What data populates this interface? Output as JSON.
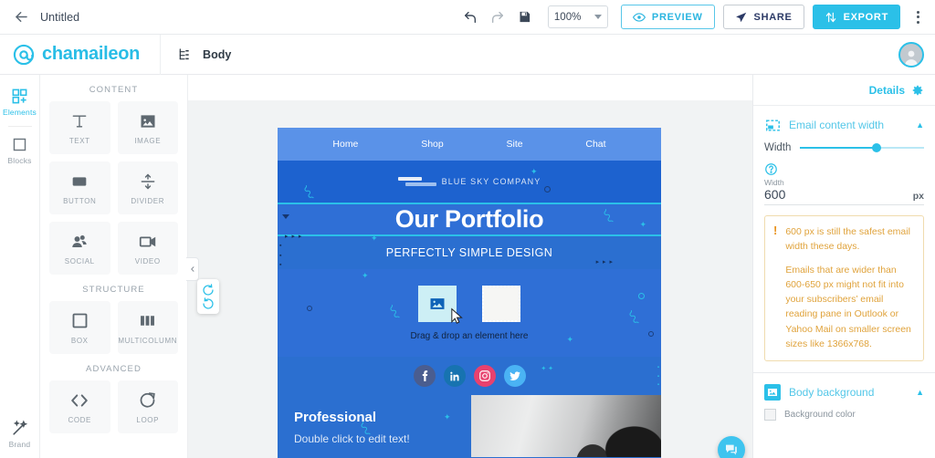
{
  "topbar": {
    "back_icon": "arrow-left-icon",
    "title": "Untitled",
    "undo_icon": "undo-icon",
    "redo_icon": "redo-icon",
    "save_icon": "save-disk-icon",
    "zoom_value": "100%",
    "preview_label": "PREVIEW",
    "preview_icon": "eye-icon",
    "share_label": "SHARE",
    "share_icon": "share-arrow-icon",
    "export_label": "EXPORT",
    "export_icon": "upload-download-icon",
    "more_icon": "kebab-menu-icon"
  },
  "logobar": {
    "logo_icon": "at-sign-icon",
    "logo_text": "chamaileon",
    "tree_icon": "structure-tree-icon",
    "breadcrumb": "Body",
    "avatar_icon": "user-avatar-icon"
  },
  "rail": {
    "items": [
      {
        "label": "Elements",
        "icon": "grid-plus-icon",
        "active": true
      },
      {
        "label": "Blocks",
        "icon": "square-outline-icon",
        "active": false
      }
    ],
    "bottom": {
      "label": "Brand",
      "icon": "magic-wand-icon"
    }
  },
  "panel": {
    "sections": [
      {
        "title": "CONTENT",
        "tiles": [
          {
            "label": "TEXT",
            "icon": "text-T-icon"
          },
          {
            "label": "IMAGE",
            "icon": "image-picture-icon"
          },
          {
            "label": "BUTTON",
            "icon": "button-rect-icon"
          },
          {
            "label": "DIVIDER",
            "icon": "divider-arrows-icon"
          },
          {
            "label": "SOCIAL",
            "icon": "people-group-icon"
          },
          {
            "label": "VIDEO",
            "icon": "video-camera-icon"
          }
        ]
      },
      {
        "title": "STRUCTURE",
        "tiles": [
          {
            "label": "BOX",
            "icon": "box-square-icon"
          },
          {
            "label": "MULTICOLUMN",
            "icon": "columns-icon"
          }
        ]
      },
      {
        "title": "ADVANCED",
        "tiles": [
          {
            "label": "CODE",
            "icon": "code-brackets-icon"
          },
          {
            "label": "LOOP",
            "icon": "loop-refresh-icon"
          }
        ]
      }
    ]
  },
  "canvas_controls": {
    "collapse_icon": "chevron-left-icon",
    "refresh_up_icon": "refresh-up-icon",
    "refresh_down_icon": "refresh-down-icon"
  },
  "email": {
    "nav": [
      "Home",
      "Shop",
      "Site",
      "Chat"
    ],
    "brand_name": "BLUE SKY COMPANY",
    "hero_title": "Our Portfolio",
    "subtitle": "PERFECTLY SIMPLE DESIGN",
    "drop_text": "Drag & drop an element here",
    "social": [
      {
        "name": "facebook-icon",
        "color": "#4a5d8f"
      },
      {
        "name": "linkedin-icon",
        "color": "#1773b0"
      },
      {
        "name": "instagram-icon",
        "color": "#e8416e"
      },
      {
        "name": "twitter-icon",
        "color": "#4ab3f4"
      }
    ],
    "professional_title": "Professional",
    "professional_sub": "Double click to edit text!"
  },
  "right": {
    "details_label": "Details",
    "gear_icon": "gear-icon",
    "width_section": {
      "icon": "content-width-icon",
      "title": "Email content width",
      "collapse_icon": "chevron-up-icon",
      "slider_label": "Width",
      "help_icon": "question-mark-icon",
      "field_label": "Width",
      "field_value": "600",
      "unit": "px"
    },
    "warning": {
      "icon": "exclamation-icon",
      "line1": "600 px is still the safest email width these days.",
      "line2": "Emails that are wider than 600-650 px might not fit into your subscribers’ email reading pane in Outlook or Yahoo Mail on smaller screen sizes like 1366x768."
    },
    "background_section": {
      "icon": "image-icon",
      "title": "Body background",
      "collapse_icon": "chevron-up-icon",
      "color_label": "Background color"
    }
  },
  "chat": {
    "icon": "chat-bubble-icon"
  },
  "colors": {
    "accent": "#2bc0e8",
    "export_bg": "#2bc0e8",
    "email_bg": "#2b6fd0",
    "email_nav_bg": "#5a92e8",
    "warning_text": "#e0a33c",
    "warning_border": "#f0dcae"
  }
}
